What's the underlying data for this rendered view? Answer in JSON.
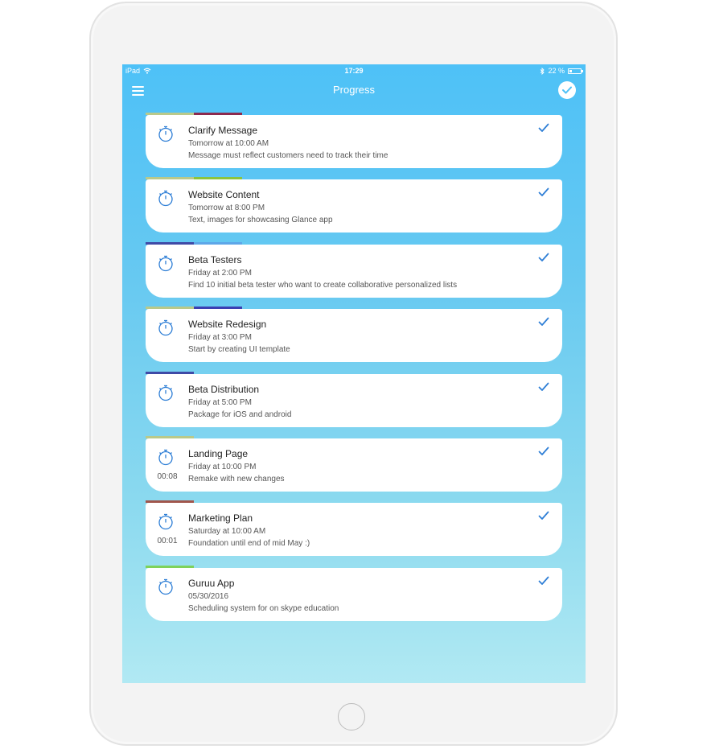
{
  "status_bar": {
    "device": "iPad",
    "time": "17:29",
    "battery": "22 %",
    "battery_fraction": 0.22
  },
  "nav": {
    "title": "Progress",
    "menu_icon": "hamburger-menu-icon",
    "done_icon": "checkmark-circle-icon"
  },
  "colors": {
    "accent": "#2f7fd6",
    "gradient_top": "#4ec1f7",
    "gradient_bottom": "#b1e9f3"
  },
  "tasks": [
    {
      "title": "Clarify Message",
      "date": "Tomorrow at 10:00 AM",
      "description": "Message must reflect customers need to track their time",
      "timer": "",
      "tags": [
        "#b9c98a",
        "#8c2a4e"
      ]
    },
    {
      "title": "Website Content",
      "date": "Tomorrow at 8:00 PM",
      "description": "Text, images for showcasing Glance app",
      "timer": "",
      "tags": [
        "#b9c98a",
        "#8cc43c"
      ]
    },
    {
      "title": "Beta Testers",
      "date": "Friday at 2:00 PM",
      "description": "Find 10 initial beta tester who want to create collaborative personalized lists",
      "timer": "",
      "tags": [
        "#3f4aa6",
        "#5ea6e8"
      ]
    },
    {
      "title": "Website Redesign",
      "date": "Friday at 3:00 PM",
      "description": "Start by creating UI template",
      "timer": "",
      "tags": [
        "#b9c98a",
        "#3b3fb2"
      ]
    },
    {
      "title": "Beta Distribution",
      "date": "Friday at 5:00 PM",
      "description": "Package for iOS and android",
      "timer": "",
      "tags": [
        "#3f4aa6"
      ]
    },
    {
      "title": "Landing Page",
      "date": "Friday at 10:00 PM",
      "description": "Remake with new changes",
      "timer": "00:08",
      "tags": [
        "#b9c98a"
      ]
    },
    {
      "title": "Marketing Plan",
      "date": "Saturday at 10:00 AM",
      "description": "Foundation until end of mid May :)",
      "timer": "00:01",
      "tags": [
        "#a0564c"
      ]
    },
    {
      "title": "Guruu App",
      "date": "05/30/2016",
      "description": "Scheduling system for on skype education",
      "timer": "",
      "tags": [
        "#7ed25a"
      ]
    }
  ]
}
